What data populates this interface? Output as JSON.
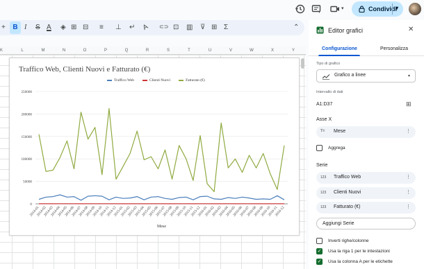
{
  "header": {
    "share_label": "Condividi"
  },
  "toolbar": {
    "plus": "+",
    "bold": "B",
    "italic": "I",
    "strike": "S",
    "text_color": "A",
    "fill": "◈",
    "borders": "⊞",
    "merge": "⊟",
    "align": "≡",
    "valign": "⊥",
    "wrap": "↵",
    "rotate": "A",
    "link": "⊂⊃",
    "comment": "⊡",
    "chart": "▥",
    "filter": "⊽",
    "views": "⊞",
    "function": "Σ",
    "collapse": "⌃"
  },
  "columns": [
    "K",
    "L",
    "M",
    "N",
    "O",
    "P",
    "Q",
    "R",
    "S",
    "T",
    "U",
    "V",
    "W",
    "X",
    "Y"
  ],
  "chart_data": {
    "type": "line",
    "title": "Traffico Web, Clienti Nuovi e Fatturato (€)",
    "xlabel": "Mese",
    "ylabel": "",
    "ylim": [
      0,
      250000
    ],
    "yticks": [
      0,
      50000,
      100000,
      150000,
      200000,
      250000
    ],
    "legend_position": "top",
    "grid": true,
    "categories": [
      "2014-01",
      "2014-02",
      "2014-03",
      "2014-04",
      "2014-05",
      "2014-06",
      "2014-07",
      "2014-08",
      "2014-09",
      "2014-10",
      "2014-11",
      "2014-12",
      "2015-01",
      "2015-02",
      "2015-03",
      "2015-04",
      "2015-05",
      "2015-06",
      "2015-07",
      "2015-08",
      "2015-09",
      "2015-10",
      "2015-11",
      "2015-12",
      "2016-01",
      "2016-02",
      "2016-03",
      "2016-04",
      "2016-05",
      "2016-06",
      "2016-07",
      "2016-08",
      "2016-09",
      "2016-10",
      "2016-11",
      "2016-12"
    ],
    "series": [
      {
        "name": "Traffico Web",
        "color": "#4a7ebb",
        "values": [
          10000,
          15000,
          16000,
          20000,
          15000,
          16000,
          8000,
          17000,
          18000,
          17000,
          9000,
          15000,
          12000,
          13000,
          16000,
          9000,
          15000,
          16000,
          12000,
          10000,
          14000,
          15000,
          9000,
          16000,
          17000,
          11000,
          10000,
          14000,
          12000,
          15000,
          13000,
          10000,
          11000,
          10000,
          18000,
          9000
        ]
      },
      {
        "name": "Clienti Nuovi",
        "color": "#cc3333",
        "values": [
          200,
          250,
          220,
          300,
          260,
          280,
          200,
          310,
          290,
          300,
          240,
          270,
          220,
          230,
          260,
          210,
          240,
          250,
          230,
          220,
          240,
          250,
          200,
          260,
          270,
          220,
          210,
          240,
          230,
          250,
          240,
          210,
          220,
          210,
          280,
          200
        ]
      },
      {
        "name": "Fatturato (€)",
        "color": "#8faa3f",
        "values": [
          155000,
          72000,
          75000,
          103000,
          140000,
          78000,
          204000,
          144000,
          170000,
          65000,
          212000,
          55000,
          83000,
          112000,
          162000,
          98000,
          105000,
          78000,
          120000,
          55000,
          130000,
          100000,
          52000,
          152000,
          45000,
          27000,
          180000,
          80000,
          100000,
          70000,
          108000,
          80000,
          112000,
          67000,
          32000,
          130000
        ]
      }
    ]
  },
  "panel": {
    "title": "Editor grafici",
    "tabs": [
      "Configurazione",
      "Personalizza"
    ],
    "chart_type_label": "Tipo di grafico",
    "chart_type_value": "Grafico a linee",
    "range_label": "Intervallo di dati",
    "range_value": "A1:D37",
    "x_axis_header": "Asse X",
    "x_axis_value": "Mese",
    "aggregate_label": "Aggrega",
    "series_header": "Serie",
    "series": [
      "Traffico Web",
      "Clienti Nuovi",
      "Fatturato (€)"
    ],
    "series_icon": "123",
    "add_series": "Aggiungi Serie",
    "options": [
      {
        "label": "Inverti righe/colonne",
        "checked": false
      },
      {
        "label": "Usa la riga 1 per le intestazioni",
        "checked": true
      },
      {
        "label": "Usa la colonna A per le etichette",
        "checked": true
      }
    ]
  }
}
